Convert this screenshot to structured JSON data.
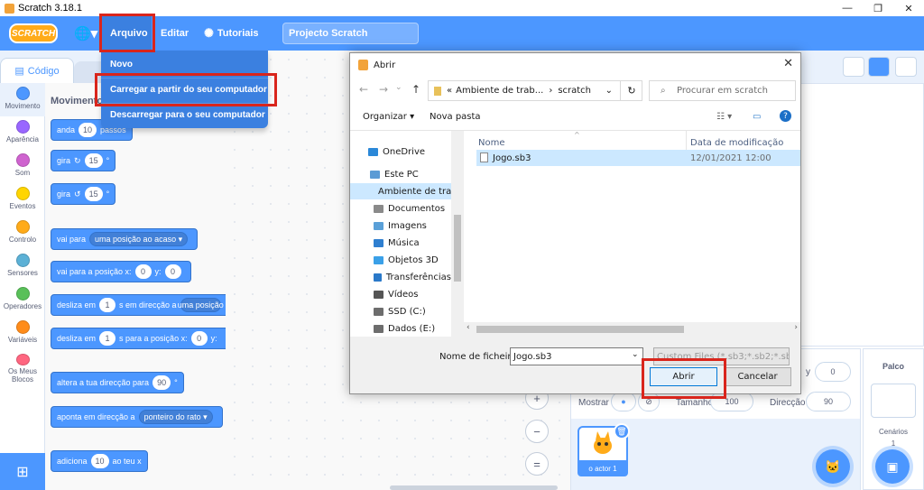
{
  "window": {
    "title": "Scratch 3.18.1",
    "minimize": "—",
    "restore": "❐",
    "close": "✕"
  },
  "menubar": {
    "logo": "SCRATCH",
    "globe": "🌐▾",
    "arquivo": "Arquivo",
    "editar": "Editar",
    "tutoriais": "Tutoriais",
    "project_title": "Projecto Scratch"
  },
  "file_menu": {
    "items": [
      "Novo",
      "Carregar a partir do seu computador",
      "Descarregar para o seu computador"
    ]
  },
  "tabs": {
    "code": "Código"
  },
  "categories": [
    {
      "label": "Movimento",
      "color": "#4c97ff"
    },
    {
      "label": "Aparência",
      "color": "#9966ff"
    },
    {
      "label": "Som",
      "color": "#cf63cf"
    },
    {
      "label": "Eventos",
      "color": "#ffd500"
    },
    {
      "label": "Controlo",
      "color": "#ffab19"
    },
    {
      "label": "Sensores",
      "color": "#5cb1d6"
    },
    {
      "label": "Operadores",
      "color": "#59c059"
    },
    {
      "label": "Variáveis",
      "color": "#ff8c1a"
    },
    {
      "label": "Os Meus Blocos",
      "color": "#ff6680"
    }
  ],
  "palette": {
    "title": "Movimento",
    "b1": {
      "a": "anda",
      "v": "10",
      "b": "passos"
    },
    "b2": {
      "a": "gira",
      "icon": "↻",
      "v": "15",
      "b": "°"
    },
    "b3": {
      "a": "gira",
      "icon": "↺",
      "v": "15",
      "b": "°"
    },
    "b4": {
      "a": "vai para",
      "v": "uma posição ao acaso ▾"
    },
    "b5": {
      "a": "vai para a posição x:",
      "v1": "0",
      "m": "y:",
      "v2": "0"
    },
    "b6": {
      "a": "desliza em",
      "v": "1",
      "b": "s em direcção a",
      "v2": "uma posição"
    },
    "b7": {
      "a": "desliza em",
      "v": "1",
      "b": "s para a posição x:",
      "v2": "0",
      "m": "y:"
    },
    "b8": {
      "a": "altera a tua direcção para",
      "v": "90",
      "b": "°"
    },
    "b9": {
      "a": "aponta em direcção a",
      "v": "ponteiro do rato ▾"
    },
    "b10": {
      "a": "adiciona",
      "v": "10",
      "b": "ao teu x"
    }
  },
  "zoom": {
    "in": "+",
    "out": "−",
    "reset": "="
  },
  "sprite_info": {
    "y_label": "y",
    "y_value": "0",
    "show_label": "Mostrar",
    "size_label": "Tamanho",
    "size_value": "100",
    "direction_label": "Direcção",
    "direction_value": "90"
  },
  "sprite": {
    "name": "o actor 1"
  },
  "stage_panel": {
    "title": "Palco",
    "backdrops_label": "Cenários",
    "backdrops_count": "1"
  },
  "dialog": {
    "title": "Abrir",
    "close": "✕",
    "path": [
      "«",
      "Ambiente de trab...",
      "›",
      "scratch"
    ],
    "search_placeholder": "Procurar em scratch",
    "organize": "Organizar ▾",
    "new_folder": "Nova pasta",
    "nav": [
      {
        "label": "OneDrive",
        "color": "#2b88d8"
      },
      {
        "label": "Este PC",
        "color": "#5b9bd5"
      },
      {
        "label": "Ambiente de trab",
        "color": "#3a96dd"
      },
      {
        "label": "Documentos",
        "color": "#8a8a8a"
      },
      {
        "label": "Imagens",
        "color": "#5aa0d8"
      },
      {
        "label": "Música",
        "color": "#2f7fd0"
      },
      {
        "label": "Objetos 3D",
        "color": "#3aa0e8"
      },
      {
        "label": "Transferências",
        "color": "#2a79c9"
      },
      {
        "label": "Vídeos",
        "color": "#555555"
      },
      {
        "label": "SSD (C:)",
        "color": "#6d6d6d"
      },
      {
        "label": "Dados (E:)",
        "color": "#6d6d6d"
      }
    ],
    "columns": {
      "name": "Nome",
      "modified": "Data de modificação"
    },
    "files": [
      {
        "name": "Jogo.sb3",
        "modified": "12/01/2021 12:00"
      }
    ],
    "filename_label": "Nome de ficheiro:",
    "filename_value": "Jogo.sb3",
    "filetype": "Custom Files (*.sb3;*.sb2;*.sb3)",
    "open": "Abrir",
    "cancel": "Cancelar"
  }
}
